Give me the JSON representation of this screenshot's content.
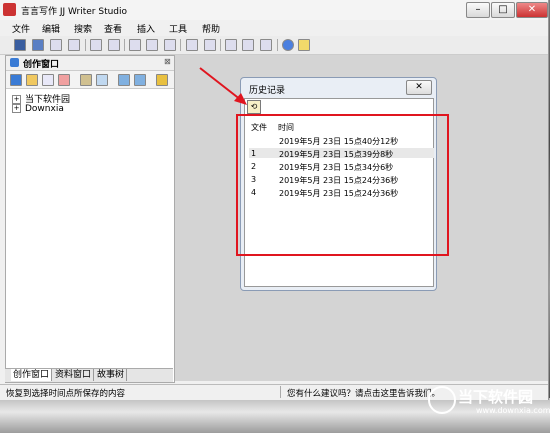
{
  "window": {
    "title": "言言写作 JJ Writer Studio"
  },
  "menu": [
    "文件",
    "编辑",
    "搜索",
    "查看",
    "插入",
    "工具",
    "帮助"
  ],
  "left_panel": {
    "title": "创作窗口",
    "tree": [
      {
        "label": "当下软件园"
      },
      {
        "label": "Downxia"
      }
    ],
    "tabs": [
      "创作窗口",
      "资料窗口",
      "故事树"
    ]
  },
  "history_dialog": {
    "title": "历史记录",
    "columns": [
      "文件",
      "时间"
    ],
    "rows": [
      {
        "file": "",
        "time": "2019年5月 23日  15点40分12秒"
      },
      {
        "file": "1",
        "time": "2019年5月 23日  15点39分8秒"
      },
      {
        "file": "2",
        "time": "2019年5月 23日  15点34分6秒"
      },
      {
        "file": "3",
        "time": "2019年5月 23日  15点24分36秒"
      },
      {
        "file": "4",
        "time": "2019年5月 23日  15点24分36秒"
      }
    ]
  },
  "status": {
    "left": "恢复到选择时间点所保存的内容",
    "right": "您有什么建议吗？请点击这里告诉我们。"
  },
  "watermark": {
    "name": "当下软件园",
    "url": "www.downxia.com"
  },
  "colors": {
    "annotation": "#e0151f"
  }
}
